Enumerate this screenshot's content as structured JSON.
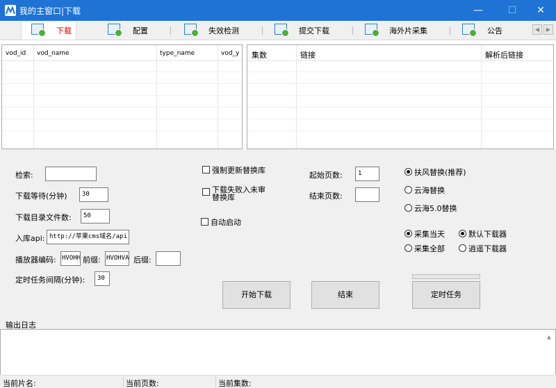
{
  "window": {
    "title": "我的主窗口|下载",
    "minimize": "—",
    "maximize": "☐",
    "close": "✕"
  },
  "tabs": [
    {
      "label": "下载",
      "active": true
    },
    {
      "label": "配置"
    },
    {
      "label": "失效检测"
    },
    {
      "label": "提交下载"
    },
    {
      "label": "海外片采集"
    },
    {
      "label": "公告"
    }
  ],
  "tab_nav": {
    "left": "◀",
    "right": "▶"
  },
  "left_grid": {
    "columns": [
      "vod_id",
      "vod_name",
      "type_name",
      "vod_y"
    ]
  },
  "right_grid": {
    "columns": [
      "集数",
      "链接",
      "解析后链接"
    ]
  },
  "form": {
    "search_label": "检索:",
    "search_value": "",
    "wait_label": "下载等待(分钟)",
    "wait_value": "30",
    "dir_count_label": "下载目录文件数:",
    "dir_count_value": "50",
    "api_label": "入库api:",
    "api_value": "http://苹果cms域名/api",
    "player_code_label": "播放器编码:",
    "player_code_value": "HVOHH",
    "prefix_label": "前缀:",
    "prefix_value": "HVOHVA",
    "suffix_label": "后缀:",
    "suffix_value": "",
    "timer_interval_label": "定时任务间隔(分钟):",
    "timer_interval_value": "30",
    "force_update_label": "强制更新替换库",
    "failed_to_unreviewed_label_1": "下载失败入未审",
    "failed_to_unreviewed_label_2": "替换库",
    "auto_start_label": "自动启动",
    "start_page_label": "起始页数:",
    "start_page_value": "1",
    "end_page_label": "结束页数:",
    "end_page_value": "",
    "replace_options": [
      {
        "label": "扶风替换(推荐)",
        "checked": true
      },
      {
        "label": "云海替换",
        "checked": false
      },
      {
        "label": "云海5.0替换",
        "checked": false
      }
    ],
    "collect_options": [
      {
        "label": "采集当天",
        "checked": true
      },
      {
        "label": "采集全部",
        "checked": false
      }
    ],
    "downloader_options": [
      {
        "label": "默认下载器",
        "checked": true
      },
      {
        "label": "逍遥下载器",
        "checked": false
      }
    ]
  },
  "buttons": {
    "start": "开始下载",
    "stop": "结束",
    "timer": "定时任务"
  },
  "output": {
    "label": "输出日志",
    "scroll_up": "▲"
  },
  "status": {
    "current_title": "当前片名:",
    "current_page": "当前页数:",
    "current_episode": "当前集数:"
  }
}
